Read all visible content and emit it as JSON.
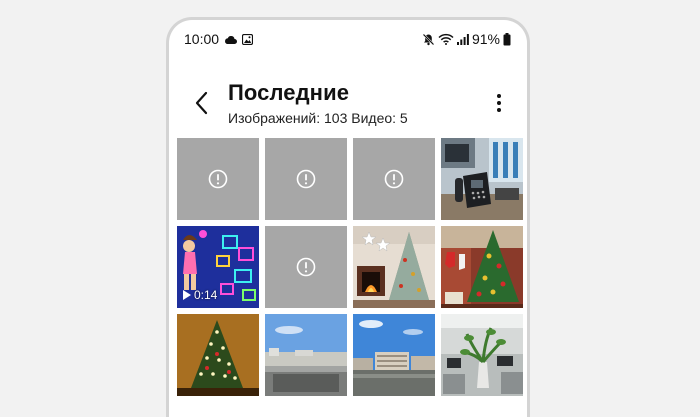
{
  "status_bar": {
    "time": "10:00",
    "left_icons": [
      "cloud-icon",
      "image-icon"
    ],
    "right_icons": [
      "mute-icon",
      "wifi-icon",
      "signal-icon",
      "battery-icon"
    ],
    "battery": "91%"
  },
  "header": {
    "title": "Последние",
    "subtitle": "Изображений: 103 Видео: 5",
    "back_icon": "chevron-left-icon",
    "menu_icon": "more-vertical-icon"
  },
  "colors": {
    "background": "#f2f2f2",
    "placeholder_tile": "#a7a7a7",
    "phone_border": "#d4d4d4"
  },
  "gallery": {
    "tiles": [
      {
        "kind": "unavailable",
        "icon": "error-icon"
      },
      {
        "kind": "unavailable",
        "icon": "error-icon"
      },
      {
        "kind": "unavailable",
        "icon": "error-icon"
      },
      {
        "kind": "photo",
        "subject": "office-desk-phone"
      },
      {
        "kind": "video",
        "subject": "cartoon-neon",
        "duration": "0:14",
        "icon": "play-icon"
      },
      {
        "kind": "unavailable",
        "icon": "error-icon"
      },
      {
        "kind": "photo",
        "subject": "christmas-tree-fireplace"
      },
      {
        "kind": "photo",
        "subject": "christmas-tree-stockings"
      },
      {
        "kind": "photo",
        "subject": "christmas-tree-lights"
      },
      {
        "kind": "photo",
        "subject": "city-rooftop-sky"
      },
      {
        "kind": "photo",
        "subject": "city-buildings-sky"
      },
      {
        "kind": "photo",
        "subject": "office-plants"
      }
    ]
  }
}
